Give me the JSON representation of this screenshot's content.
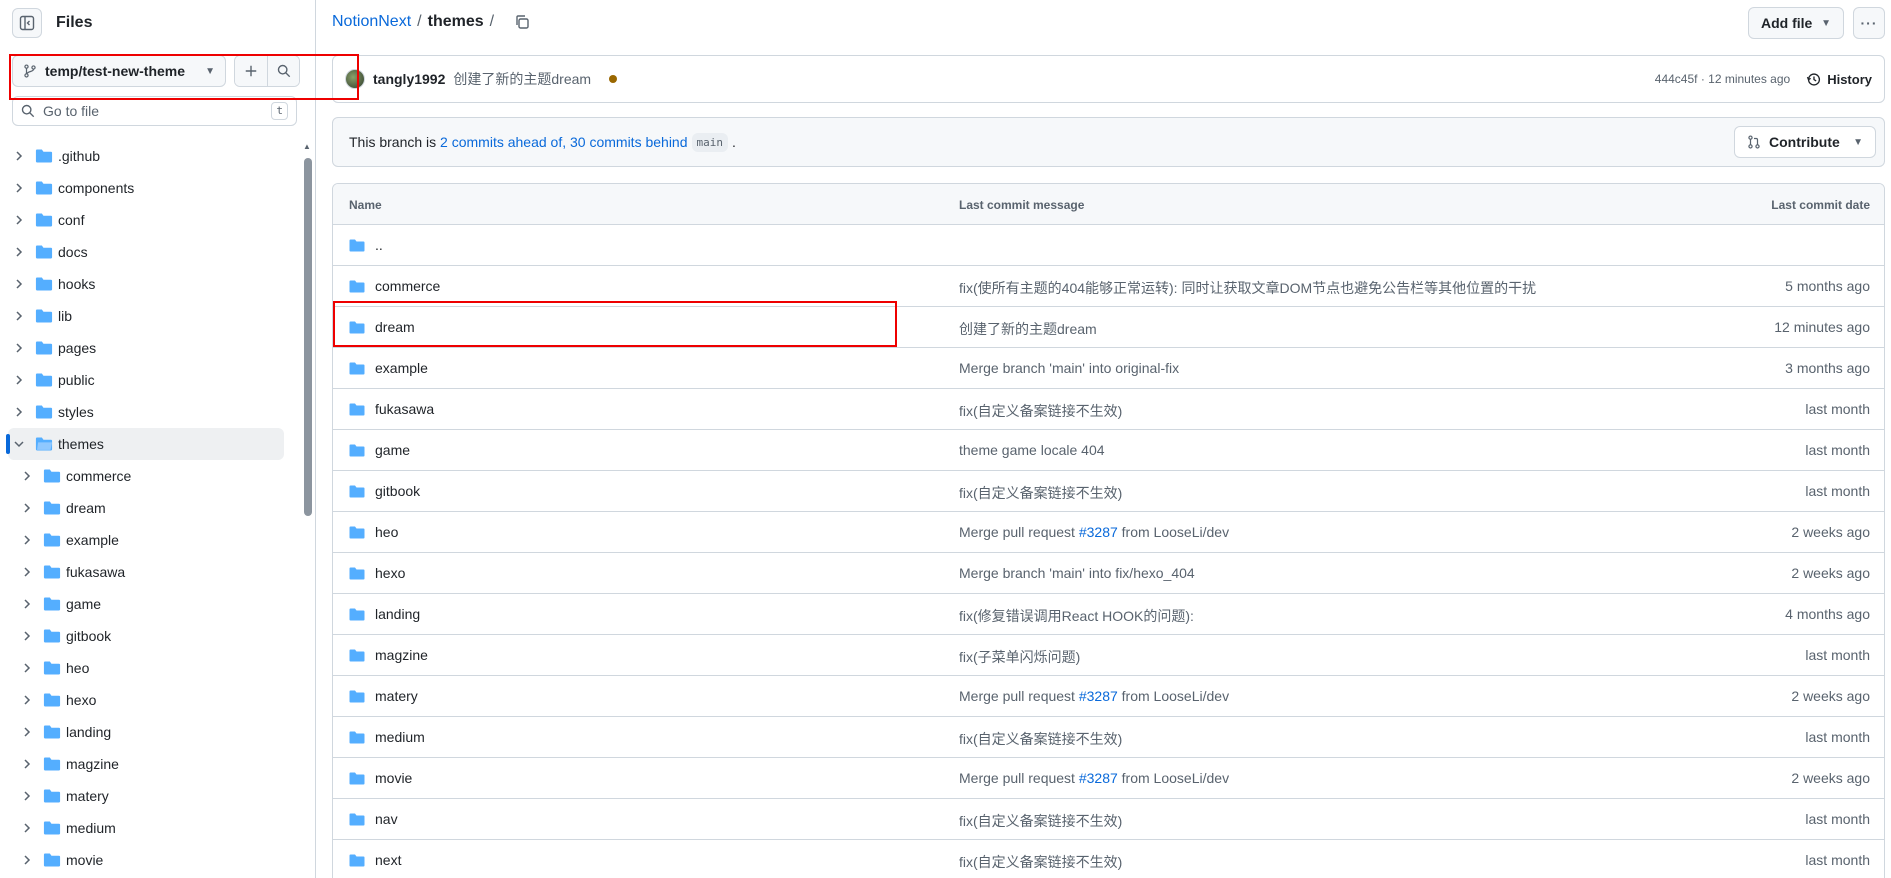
{
  "sidebar": {
    "title": "Files",
    "branch": "temp/test-new-theme",
    "goto_placeholder": "Go to file",
    "goto_shortcut": "t",
    "tree": [
      {
        "label": ".github",
        "level": 0
      },
      {
        "label": "components",
        "level": 0
      },
      {
        "label": "conf",
        "level": 0
      },
      {
        "label": "docs",
        "level": 0
      },
      {
        "label": "hooks",
        "level": 0
      },
      {
        "label": "lib",
        "level": 0
      },
      {
        "label": "pages",
        "level": 0
      },
      {
        "label": "public",
        "level": 0
      },
      {
        "label": "styles",
        "level": 0
      },
      {
        "label": "themes",
        "level": 0,
        "expanded": true,
        "active": true
      },
      {
        "label": "commerce",
        "level": 1
      },
      {
        "label": "dream",
        "level": 1
      },
      {
        "label": "example",
        "level": 1
      },
      {
        "label": "fukasawa",
        "level": 1
      },
      {
        "label": "game",
        "level": 1
      },
      {
        "label": "gitbook",
        "level": 1
      },
      {
        "label": "heo",
        "level": 1
      },
      {
        "label": "hexo",
        "level": 1
      },
      {
        "label": "landing",
        "level": 1
      },
      {
        "label": "magzine",
        "level": 1
      },
      {
        "label": "matery",
        "level": 1
      },
      {
        "label": "medium",
        "level": 1
      },
      {
        "label": "movie",
        "level": 1
      }
    ]
  },
  "header": {
    "repo": "NotionNext",
    "sep": "/",
    "path": "themes",
    "trailing_sep": "/",
    "add_file": "Add file",
    "more": "···"
  },
  "commit": {
    "user": "tangly1992",
    "message": "创建了新的主题dream",
    "meta": "444c45f · 12 minutes ago",
    "history": "History"
  },
  "branch_info": {
    "prefix": "This branch is",
    "ahead": "2 commits ahead of,",
    "behind": "30 commits behind",
    "base": "main",
    "suffix": ".",
    "contribute": "Contribute"
  },
  "table": {
    "headers": {
      "name": "Name",
      "message": "Last commit message",
      "date": "Last commit date"
    },
    "rows": [
      {
        "name": "..",
        "message": "",
        "date": ""
      },
      {
        "name": "commerce",
        "message": "fix(使所有主题的404能够正常运转): 同时让获取文章DOM节点也避免公告栏等其他位置的干扰",
        "date": "5 months ago"
      },
      {
        "name": "dream",
        "message": "创建了新的主题dream",
        "date": "12 minutes ago"
      },
      {
        "name": "example",
        "message": "Merge branch 'main' into original-fix",
        "date": "3 months ago"
      },
      {
        "name": "fukasawa",
        "message": "fix(自定义备案链接不生效)",
        "date": "last month"
      },
      {
        "name": "game",
        "message": "theme game locale 404",
        "date": "last month"
      },
      {
        "name": "gitbook",
        "message": "fix(自定义备案链接不生效)",
        "date": "last month"
      },
      {
        "name": "heo",
        "message": "Merge pull request ",
        "message_link": "#3287",
        "message_after": " from LooseLi/dev",
        "date": "2 weeks ago"
      },
      {
        "name": "hexo",
        "message": "Merge branch 'main' into fix/hexo_404",
        "date": "2 weeks ago"
      },
      {
        "name": "landing",
        "message": "fix(修复错误调用React HOOK的问题):",
        "date": "4 months ago"
      },
      {
        "name": "magzine",
        "message": "fix(子菜单闪烁问题)",
        "date": "last month"
      },
      {
        "name": "matery",
        "message": "Merge pull request ",
        "message_link": "#3287",
        "message_after": " from LooseLi/dev",
        "date": "2 weeks ago"
      },
      {
        "name": "medium",
        "message": "fix(自定义备案链接不生效)",
        "date": "last month"
      },
      {
        "name": "movie",
        "message": "Merge pull request ",
        "message_link": "#3287",
        "message_after": " from LooseLi/dev",
        "date": "2 weeks ago"
      },
      {
        "name": "nav",
        "message": "fix(自定义备案链接不生效)",
        "date": "last month"
      },
      {
        "name": "next",
        "message": "fix(自定义备案链接不生效)",
        "date": "last month"
      }
    ]
  },
  "colors": {
    "accent": "#0969da",
    "folder": "#54aeff",
    "highlight": "#ee0000",
    "border": "#d0d7de"
  }
}
